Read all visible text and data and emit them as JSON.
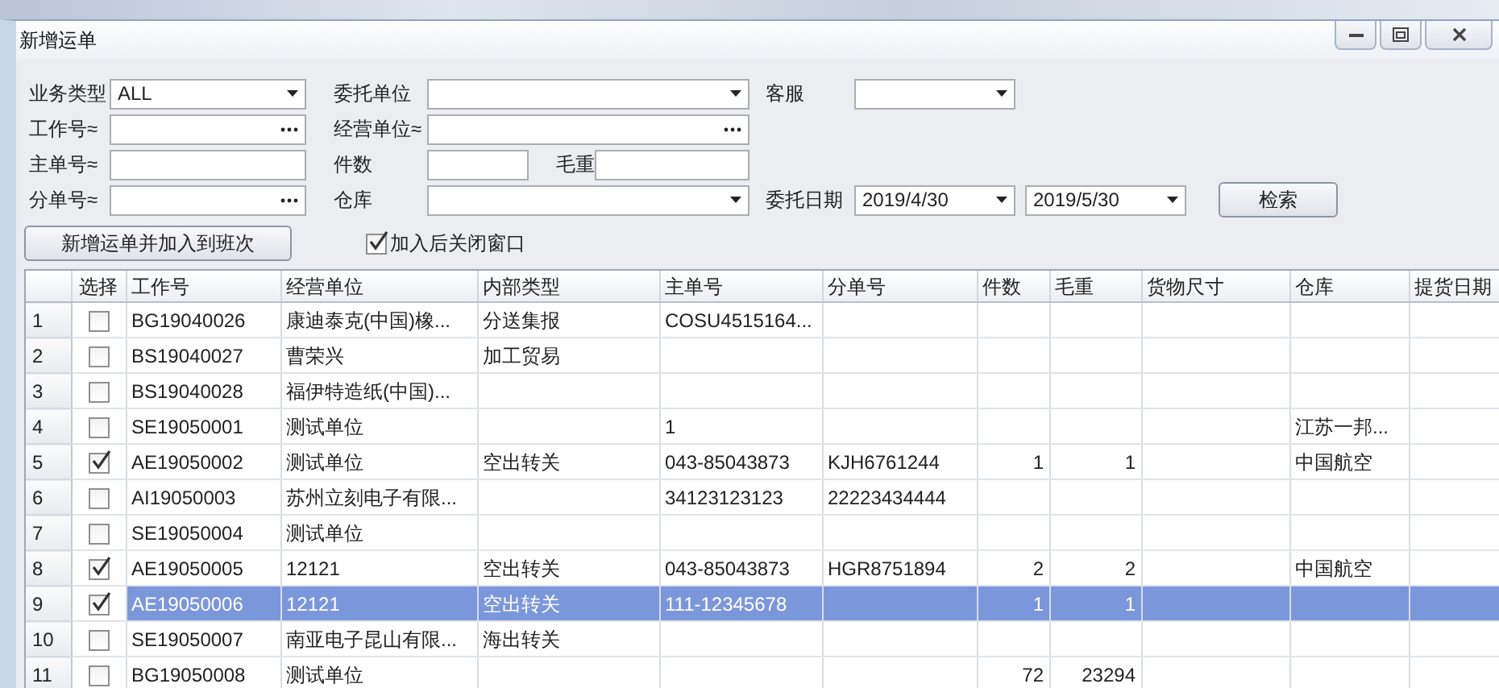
{
  "window": {
    "title": "新增运单"
  },
  "filters": [
    [
      {
        "label": "业务类型",
        "kind": "combo",
        "value": "ALL"
      },
      {
        "label": "委托单位",
        "kind": "combo"
      },
      {
        "label": "客服",
        "kind": "combo"
      }
    ],
    [
      {
        "label": "工作号≈",
        "kind": "lookup"
      },
      {
        "label": "经营单位≈",
        "kind": "lookup"
      }
    ],
    [
      {
        "label": "主单号≈",
        "kind": "text"
      },
      {
        "label": "件数",
        "kind": "text"
      },
      {
        "label": "毛重",
        "kind": "text"
      }
    ],
    [
      {
        "label": "分单号≈",
        "kind": "lookup"
      },
      {
        "label": "仓库",
        "kind": "combo"
      },
      {
        "label": "委托日期",
        "kind": "combo",
        "value": "2019/4/30"
      },
      {
        "kind": "combo",
        "value": "2019/5/30"
      },
      {
        "kind": "button",
        "label": "检索"
      }
    ]
  ],
  "toolbar": {
    "button": "新增运单并加入到班次",
    "checkbox": {
      "label": "加入后关闭窗口",
      "checked": true
    }
  },
  "table": {
    "columns": [
      {
        "label": "选择",
        "kind": "check"
      },
      {
        "label": "工作号",
        "kind": "text"
      },
      {
        "label": "经营单位",
        "kind": "text"
      },
      {
        "label": "内部类型",
        "kind": "text"
      },
      {
        "label": "主单号",
        "kind": "text"
      },
      {
        "label": "分单号",
        "kind": "text"
      },
      {
        "label": "件数",
        "kind": "number"
      },
      {
        "label": "毛重",
        "kind": "number"
      },
      {
        "label": "货物尺寸",
        "kind": "text"
      },
      {
        "label": "仓库",
        "kind": "text"
      },
      {
        "label": "提货日期",
        "kind": "text"
      }
    ],
    "rows": [
      {
        "num": "1",
        "checked": false,
        "selected": false,
        "cells": [
          "",
          "BG19040026",
          "康迪泰克(中国)橡...",
          "分送集报",
          "COSU4515164...",
          "",
          "",
          "",
          "",
          "",
          ""
        ]
      },
      {
        "num": "2",
        "checked": false,
        "selected": false,
        "cells": [
          "",
          "BS19040027",
          "曹荣兴",
          "加工贸易",
          "",
          "",
          "",
          "",
          "",
          "",
          ""
        ]
      },
      {
        "num": "3",
        "checked": false,
        "selected": false,
        "cells": [
          "",
          "BS19040028",
          "福伊特造纸(中国)...",
          "",
          "",
          "",
          "",
          "",
          "",
          "",
          ""
        ]
      },
      {
        "num": "4",
        "checked": false,
        "selected": false,
        "cells": [
          "",
          "SE19050001",
          "测试单位",
          "",
          "1",
          "",
          "",
          "",
          "",
          "江苏一邦...",
          ""
        ]
      },
      {
        "num": "5",
        "checked": true,
        "selected": false,
        "cells": [
          "",
          "AE19050002",
          "测试单位",
          "空出转关",
          "043-85043873",
          "KJH6761244",
          "1",
          "1",
          "",
          "中国航空",
          ""
        ]
      },
      {
        "num": "6",
        "checked": false,
        "selected": false,
        "cells": [
          "",
          "AI19050003",
          "苏州立刻电子有限...",
          "",
          "34123123123",
          "22223434444",
          "",
          "",
          "",
          "",
          ""
        ]
      },
      {
        "num": "7",
        "checked": false,
        "selected": false,
        "cells": [
          "",
          "SE19050004",
          "测试单位",
          "",
          "",
          "",
          "",
          "",
          "",
          "",
          ""
        ]
      },
      {
        "num": "8",
        "checked": true,
        "selected": false,
        "cells": [
          "",
          "AE19050005",
          "12121",
          "空出转关",
          "043-85043873",
          "HGR8751894",
          "2",
          "2",
          "",
          "中国航空",
          ""
        ]
      },
      {
        "num": "9",
        "checked": true,
        "selected": true,
        "cells": [
          "",
          "AE19050006",
          "12121",
          "空出转关",
          "111-12345678",
          "",
          "1",
          "1",
          "",
          "",
          ""
        ]
      },
      {
        "num": "10",
        "checked": false,
        "selected": false,
        "cells": [
          "",
          "SE19050007",
          "南亚电子昆山有限...",
          "海出转关",
          "",
          "",
          "",
          "",
          "",
          "",
          ""
        ]
      },
      {
        "num": "11",
        "checked": false,
        "selected": false,
        "cells": [
          "",
          "BG19050008",
          "测试单位",
          "",
          "",
          "",
          "72",
          "23294",
          "",
          "",
          ""
        ]
      }
    ]
  }
}
